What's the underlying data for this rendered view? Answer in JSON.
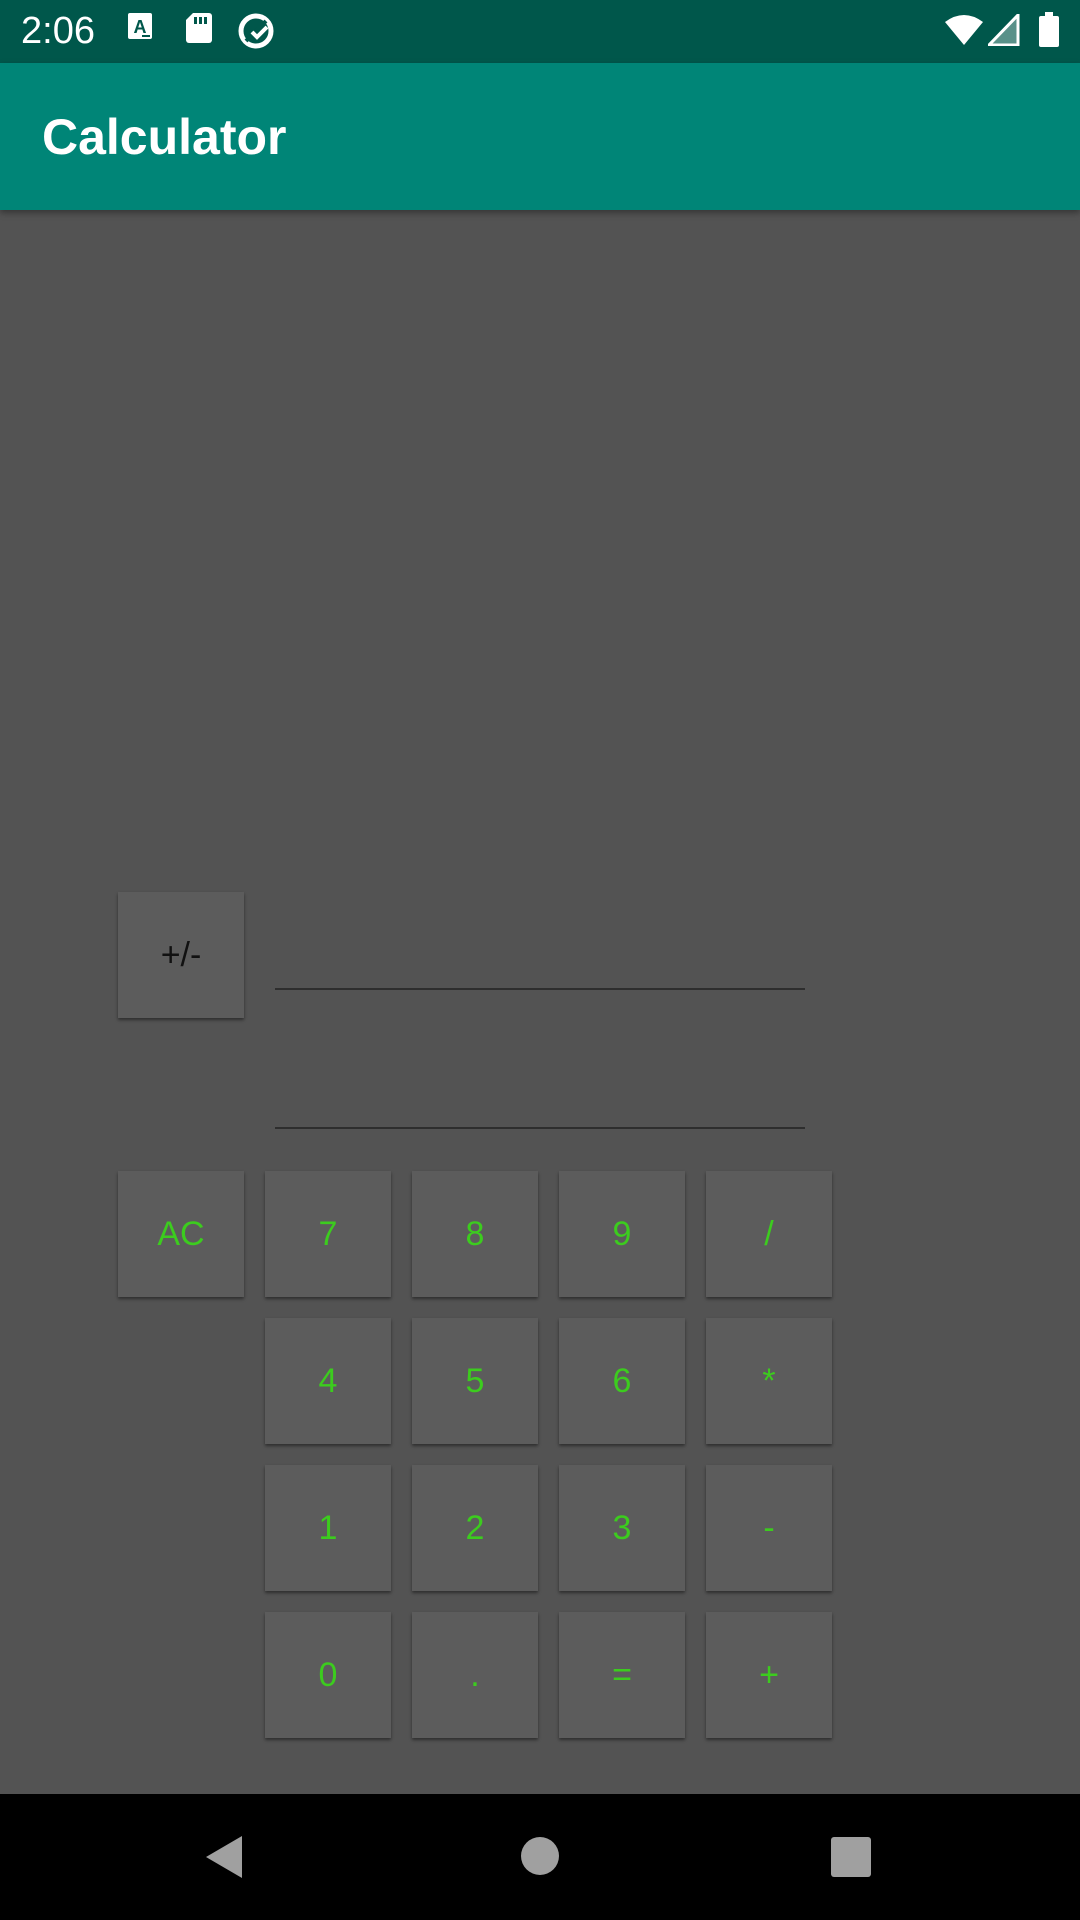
{
  "status_bar": {
    "time": "2:06",
    "left_icons": [
      "a-notification-icon",
      "sd-card-icon",
      "vpn-icon"
    ],
    "right_icons": [
      "wifi-icon",
      "signal-icon",
      "battery-icon"
    ]
  },
  "app_bar": {
    "title": "Calculator"
  },
  "display": {
    "sign_button_label": "+/-",
    "input_value": "",
    "result_value": ""
  },
  "keypad": {
    "ac": "AC",
    "seven": "7",
    "eight": "8",
    "nine": "9",
    "divide": "/",
    "four": "4",
    "five": "5",
    "six": "6",
    "multiply": "*",
    "one": "1",
    "two": "2",
    "three": "3",
    "subtract": "-",
    "zero": "0",
    "dot": ".",
    "equals": "=",
    "add": "+"
  },
  "nav_bar": {
    "icons": [
      "back-icon",
      "home-icon",
      "recents-icon"
    ]
  },
  "colors": {
    "status_bar": "#00574b",
    "app_bar": "#008577",
    "background": "#535353",
    "button": "#5c5c5c",
    "button_text": "#3ccc1e"
  }
}
